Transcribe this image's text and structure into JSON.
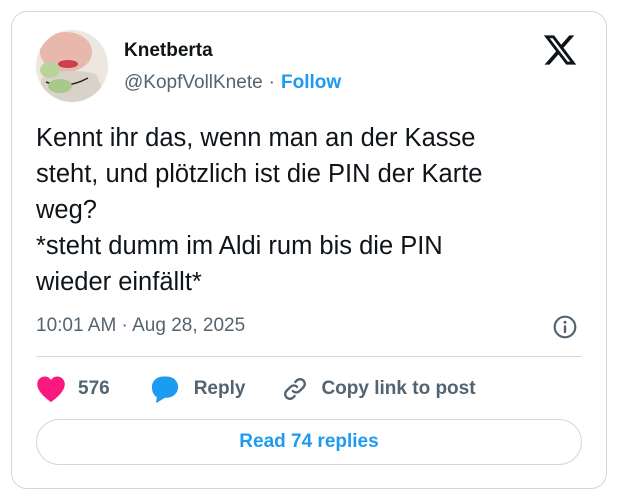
{
  "author": {
    "display_name": "Knetberta",
    "handle": "@KopfVollKnete",
    "separator": "·",
    "follow_label": "Follow"
  },
  "tweet": {
    "text": "Kennt ihr das, wenn man an der Kasse\nsteht, und plötzlich ist die PIN der Karte\nweg?\n*steht dumm im Aldi rum bis die PIN\nwieder einfällt*",
    "timestamp": "10:01 AM · Aug 28, 2025"
  },
  "actions": {
    "like_count": "576",
    "reply_label": "Reply",
    "copy_link_label": "Copy link to post"
  },
  "read_replies_label": "Read 74 replies",
  "icons": {
    "logo": "x-logo-icon",
    "info": "info-icon",
    "like": "heart-icon",
    "reply": "speech-bubble-icon",
    "copy": "link-icon"
  },
  "colors": {
    "accent": "#1d9bf0",
    "like": "#f91880",
    "text_primary": "#0f1419",
    "text_secondary": "#536471",
    "border": "#cfd9de"
  }
}
